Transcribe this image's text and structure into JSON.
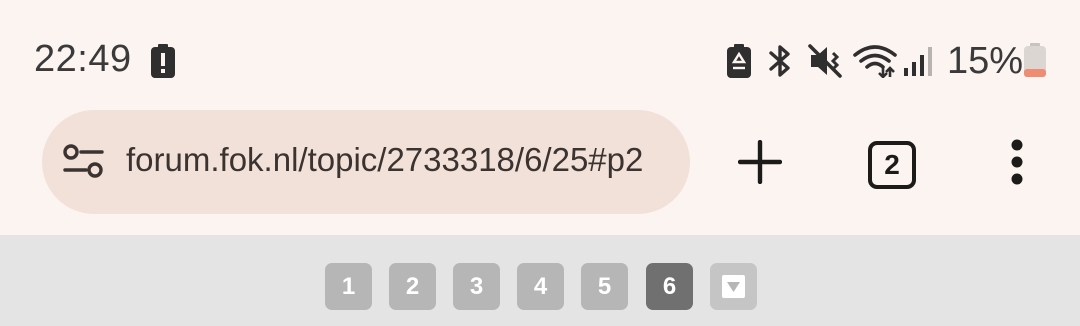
{
  "status_bar": {
    "time": "22:49",
    "battery_percent": "15%",
    "icons": [
      "battery-alert-icon",
      "battery-saver-icon",
      "bluetooth-icon",
      "mute-vibrate-icon",
      "wifi-icon",
      "signal-icon",
      "battery-icon"
    ]
  },
  "browser": {
    "url": "forum.fok.nl/topic/2733318/6/25#p2",
    "tab_count": "2",
    "icons": [
      "site-settings-icon",
      "new-tab-icon",
      "tabs-icon",
      "more-menu-icon"
    ]
  },
  "pagination": {
    "pages": [
      "1",
      "2",
      "3",
      "4",
      "5",
      "6"
    ],
    "current_page": "6",
    "next_icon": "chevron-down-icon"
  },
  "colors": {
    "background": "#fcf4f1",
    "url_pill": "#f2e1d9",
    "page_button": "#b6b6b6",
    "page_button_current": "#707070"
  }
}
